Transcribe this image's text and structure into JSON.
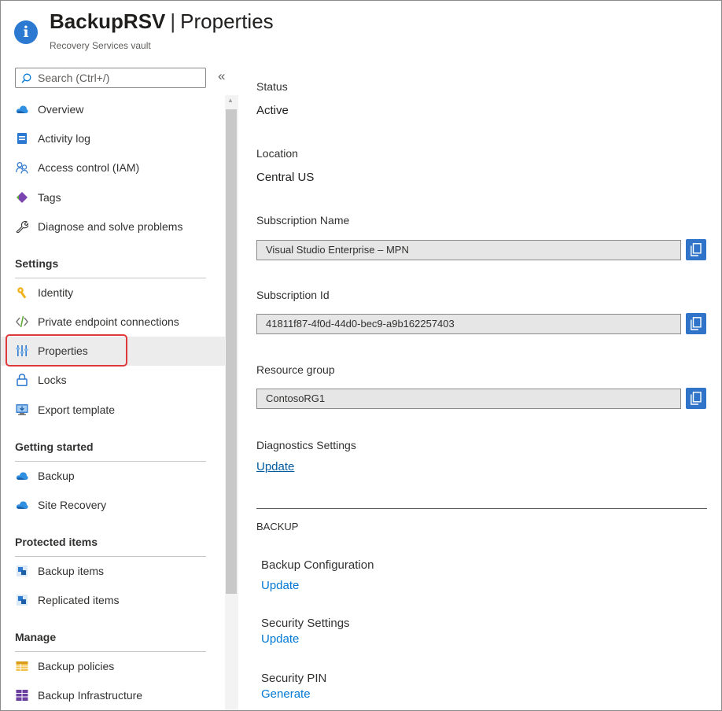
{
  "header": {
    "resource_name": "BackupRSV",
    "separator": "|",
    "page_name": "Properties",
    "subtitle": "Recovery Services vault",
    "icon": "info-icon"
  },
  "sidebar": {
    "search_placeholder": "Search (Ctrl+/)",
    "collapse_label": "«",
    "items_top": [
      {
        "label": "Overview",
        "icon": "overview-icon"
      },
      {
        "label": "Activity log",
        "icon": "activity-log-icon"
      },
      {
        "label": "Access control (IAM)",
        "icon": "iam-icon"
      },
      {
        "label": "Tags",
        "icon": "tag-icon"
      },
      {
        "label": "Diagnose and solve problems",
        "icon": "wrench-icon"
      }
    ],
    "settings": {
      "header": "Settings",
      "items": [
        {
          "label": "Identity",
          "icon": "identity-key-icon"
        },
        {
          "label": "Private endpoint connections",
          "icon": "private-endpoint-icon"
        },
        {
          "label": "Properties",
          "icon": "properties-icon",
          "selected": true
        },
        {
          "label": "Locks",
          "icon": "lock-icon"
        },
        {
          "label": "Export template",
          "icon": "export-template-icon"
        }
      ]
    },
    "getting_started": {
      "header": "Getting started",
      "items": [
        {
          "label": "Backup",
          "icon": "backup-cloud-icon"
        },
        {
          "label": "Site Recovery",
          "icon": "site-recovery-cloud-icon"
        }
      ]
    },
    "protected_items": {
      "header": "Protected items",
      "items": [
        {
          "label": "Backup items",
          "icon": "backup-items-icon"
        },
        {
          "label": "Replicated items",
          "icon": "replicated-items-icon"
        }
      ]
    },
    "manage": {
      "header": "Manage",
      "items": [
        {
          "label": "Backup policies",
          "icon": "backup-policies-icon"
        },
        {
          "label": "Backup Infrastructure",
          "icon": "backup-infrastructure-icon"
        }
      ]
    }
  },
  "main": {
    "status": {
      "label": "Status",
      "value": "Active"
    },
    "location": {
      "label": "Location",
      "value": "Central US"
    },
    "subscription_name": {
      "label": "Subscription Name",
      "value": "Visual Studio Enterprise – MPN"
    },
    "subscription_id": {
      "label": "Subscription Id",
      "value": "41811f87-4f0d-44d0-bec9-a9b162257403"
    },
    "resource_group": {
      "label": "Resource group",
      "value": "ContosoRG1"
    },
    "diagnostics": {
      "label": "Diagnostics Settings",
      "link": "Update"
    },
    "backup_section": {
      "header": "BACKUP",
      "backup_configuration": {
        "label": "Backup Configuration",
        "link": "Update"
      },
      "security_settings": {
        "label": "Security Settings",
        "link": "Update"
      },
      "security_pin": {
        "label": "Security PIN",
        "link": "Generate"
      }
    }
  },
  "colors": {
    "accent": "#0078d4",
    "copy_button": "#2f74c9",
    "selection_highlight": "#e0393b",
    "selected_bg": "#ececec"
  }
}
